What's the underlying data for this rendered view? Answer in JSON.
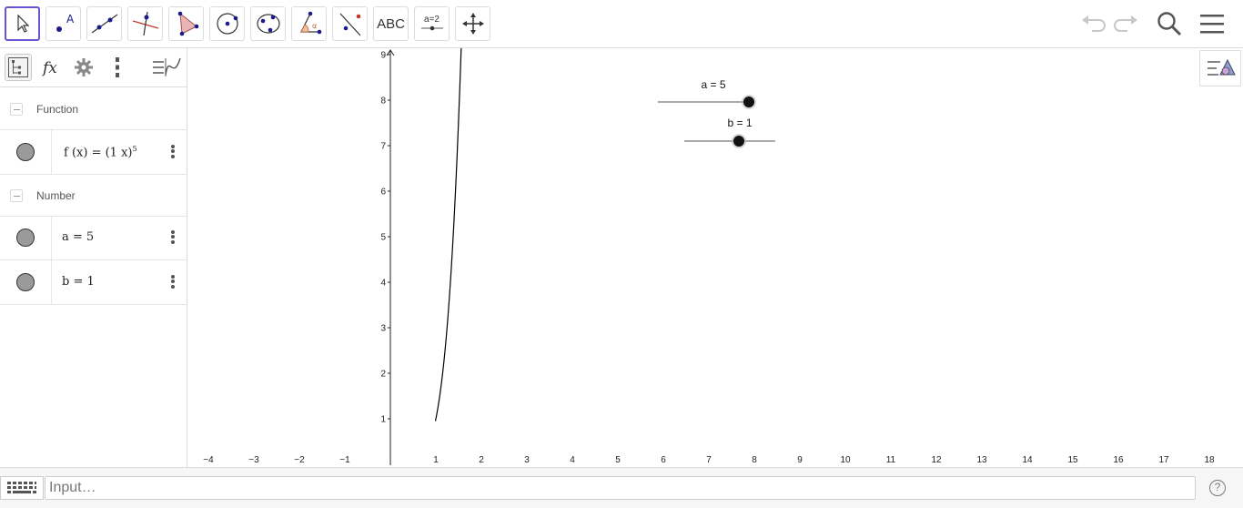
{
  "toolbar": {
    "tools": [
      {
        "name": "move-tool",
        "active": true
      },
      {
        "name": "point-tool"
      },
      {
        "name": "line-tool"
      },
      {
        "name": "perpendicular-line-tool"
      },
      {
        "name": "polygon-tool"
      },
      {
        "name": "circle-center-point-tool"
      },
      {
        "name": "conic-tool"
      },
      {
        "name": "angle-tool"
      },
      {
        "name": "reflect-tool"
      },
      {
        "name": "text-tool",
        "label": "ABC"
      },
      {
        "name": "slider-tool",
        "label": "a=2"
      },
      {
        "name": "move-graphics-view-tool"
      }
    ],
    "right": [
      "undo-icon",
      "redo-icon",
      "search-icon",
      "menu-icon"
    ]
  },
  "algebra": {
    "groups": [
      {
        "label": "Function",
        "items": [
          {
            "lhs": "f (x)",
            "rhs": "(1 x)",
            "exp": "5"
          }
        ]
      },
      {
        "label": "Number",
        "items": [
          {
            "text": "a = 5"
          },
          {
            "text": "b = 1"
          }
        ]
      }
    ]
  },
  "graphics": {
    "sliders": [
      {
        "label": "a = 5",
        "value": 5,
        "min": -5,
        "max": 5
      },
      {
        "label": "b = 1",
        "value": 1,
        "min": -5,
        "max": 5
      }
    ],
    "x_ticks": [
      "−4",
      "−3",
      "−2",
      "−1",
      "1",
      "2",
      "3",
      "4",
      "5",
      "6",
      "7",
      "8",
      "9",
      "10",
      "11",
      "12",
      "13",
      "14",
      "15",
      "16",
      "17",
      "18"
    ],
    "y_ticks": [
      "1",
      "2",
      "3",
      "4",
      "5",
      "6",
      "7",
      "8",
      "9"
    ]
  },
  "inputbar": {
    "placeholder": "Input…",
    "help": "?"
  }
}
